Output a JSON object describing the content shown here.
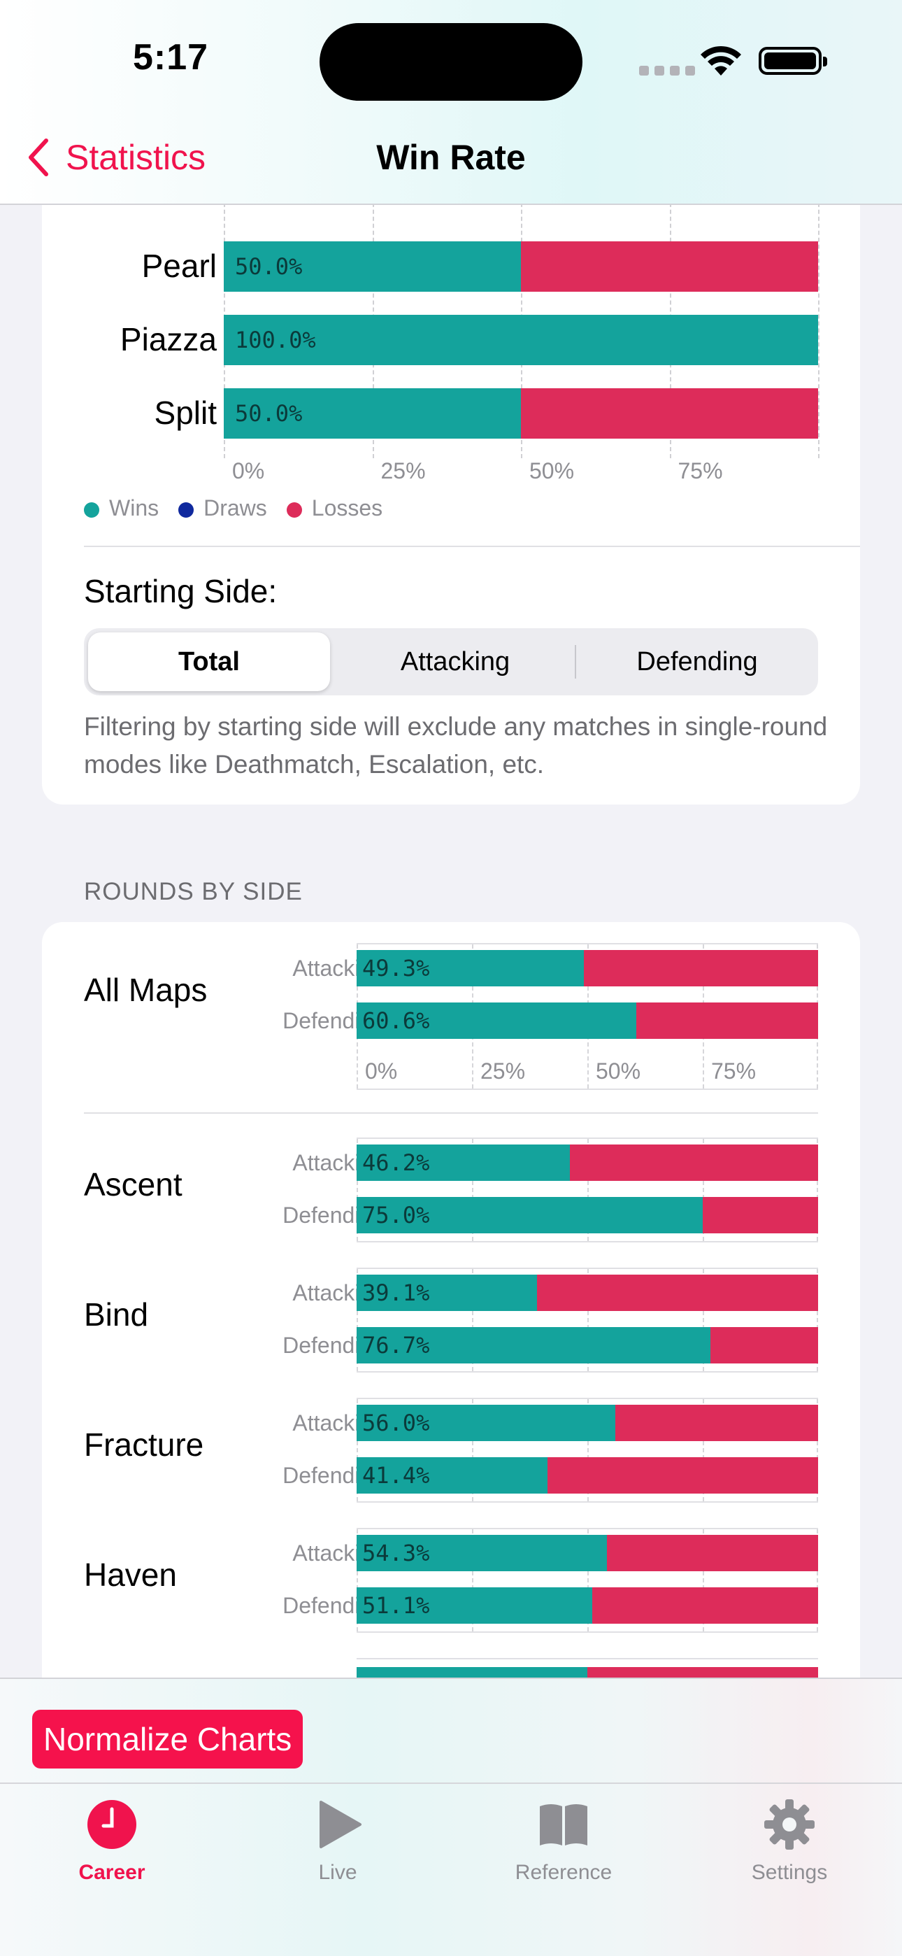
{
  "status": {
    "time": "5:17"
  },
  "nav": {
    "back_label": "Statistics",
    "title": "Win Rate"
  },
  "colors": {
    "wins": "#14a39c",
    "draws": "#10299e",
    "losses": "#dd2c5a",
    "accent": "#f0134d"
  },
  "map_winrate": {
    "rows": [
      {
        "map": "Pearl",
        "wins_pct": 50.0,
        "label": "50.0%"
      },
      {
        "map": "Piazza",
        "wins_pct": 100.0,
        "label": "100.0%"
      },
      {
        "map": "Split",
        "wins_pct": 50.0,
        "label": "50.0%"
      }
    ],
    "ticks": [
      "0%",
      "25%",
      "50%",
      "75%"
    ],
    "legend": [
      "Wins",
      "Draws",
      "Losses"
    ]
  },
  "starting_side": {
    "label": "Starting Side:",
    "options": [
      "Total",
      "Attacking",
      "Defending"
    ],
    "selected": "Total",
    "footnote": "Filtering by starting side will exclude any matches in single-round modes like Deathmatch, Escalation, etc."
  },
  "rounds_by_side": {
    "header": "ROUNDS BY SIDE",
    "attacking_label": "Attacking",
    "defending_label": "Defending",
    "ticks": [
      "0%",
      "25%",
      "50%",
      "75%"
    ],
    "all_maps": {
      "name": "All Maps",
      "attacking": 49.3,
      "attacking_label": "49.3%",
      "defending": 60.6,
      "defending_label": "60.6%"
    },
    "maps": [
      {
        "name": "Ascent",
        "attacking": 46.2,
        "attacking_label": "46.2%",
        "defending": 75.0,
        "defending_label": "75.0%"
      },
      {
        "name": "Bind",
        "attacking": 39.1,
        "attacking_label": "39.1%",
        "defending": 76.7,
        "defending_label": "76.7%"
      },
      {
        "name": "Fracture",
        "attacking": 56.0,
        "attacking_label": "56.0%",
        "defending": 41.4,
        "defending_label": "41.4%"
      },
      {
        "name": "Haven",
        "attacking": 54.3,
        "attacking_label": "54.3%",
        "defending": 51.1,
        "defending_label": "51.1%"
      }
    ]
  },
  "actions": {
    "normalize_label": "Normalize Charts"
  },
  "tabbar": {
    "items": [
      {
        "label": "Career",
        "icon": "career-clock-icon",
        "active": true
      },
      {
        "label": "Live",
        "icon": "play-icon",
        "active": false
      },
      {
        "label": "Reference",
        "icon": "book-icon",
        "active": false
      },
      {
        "label": "Settings",
        "icon": "gear-icon",
        "active": false
      }
    ]
  }
}
